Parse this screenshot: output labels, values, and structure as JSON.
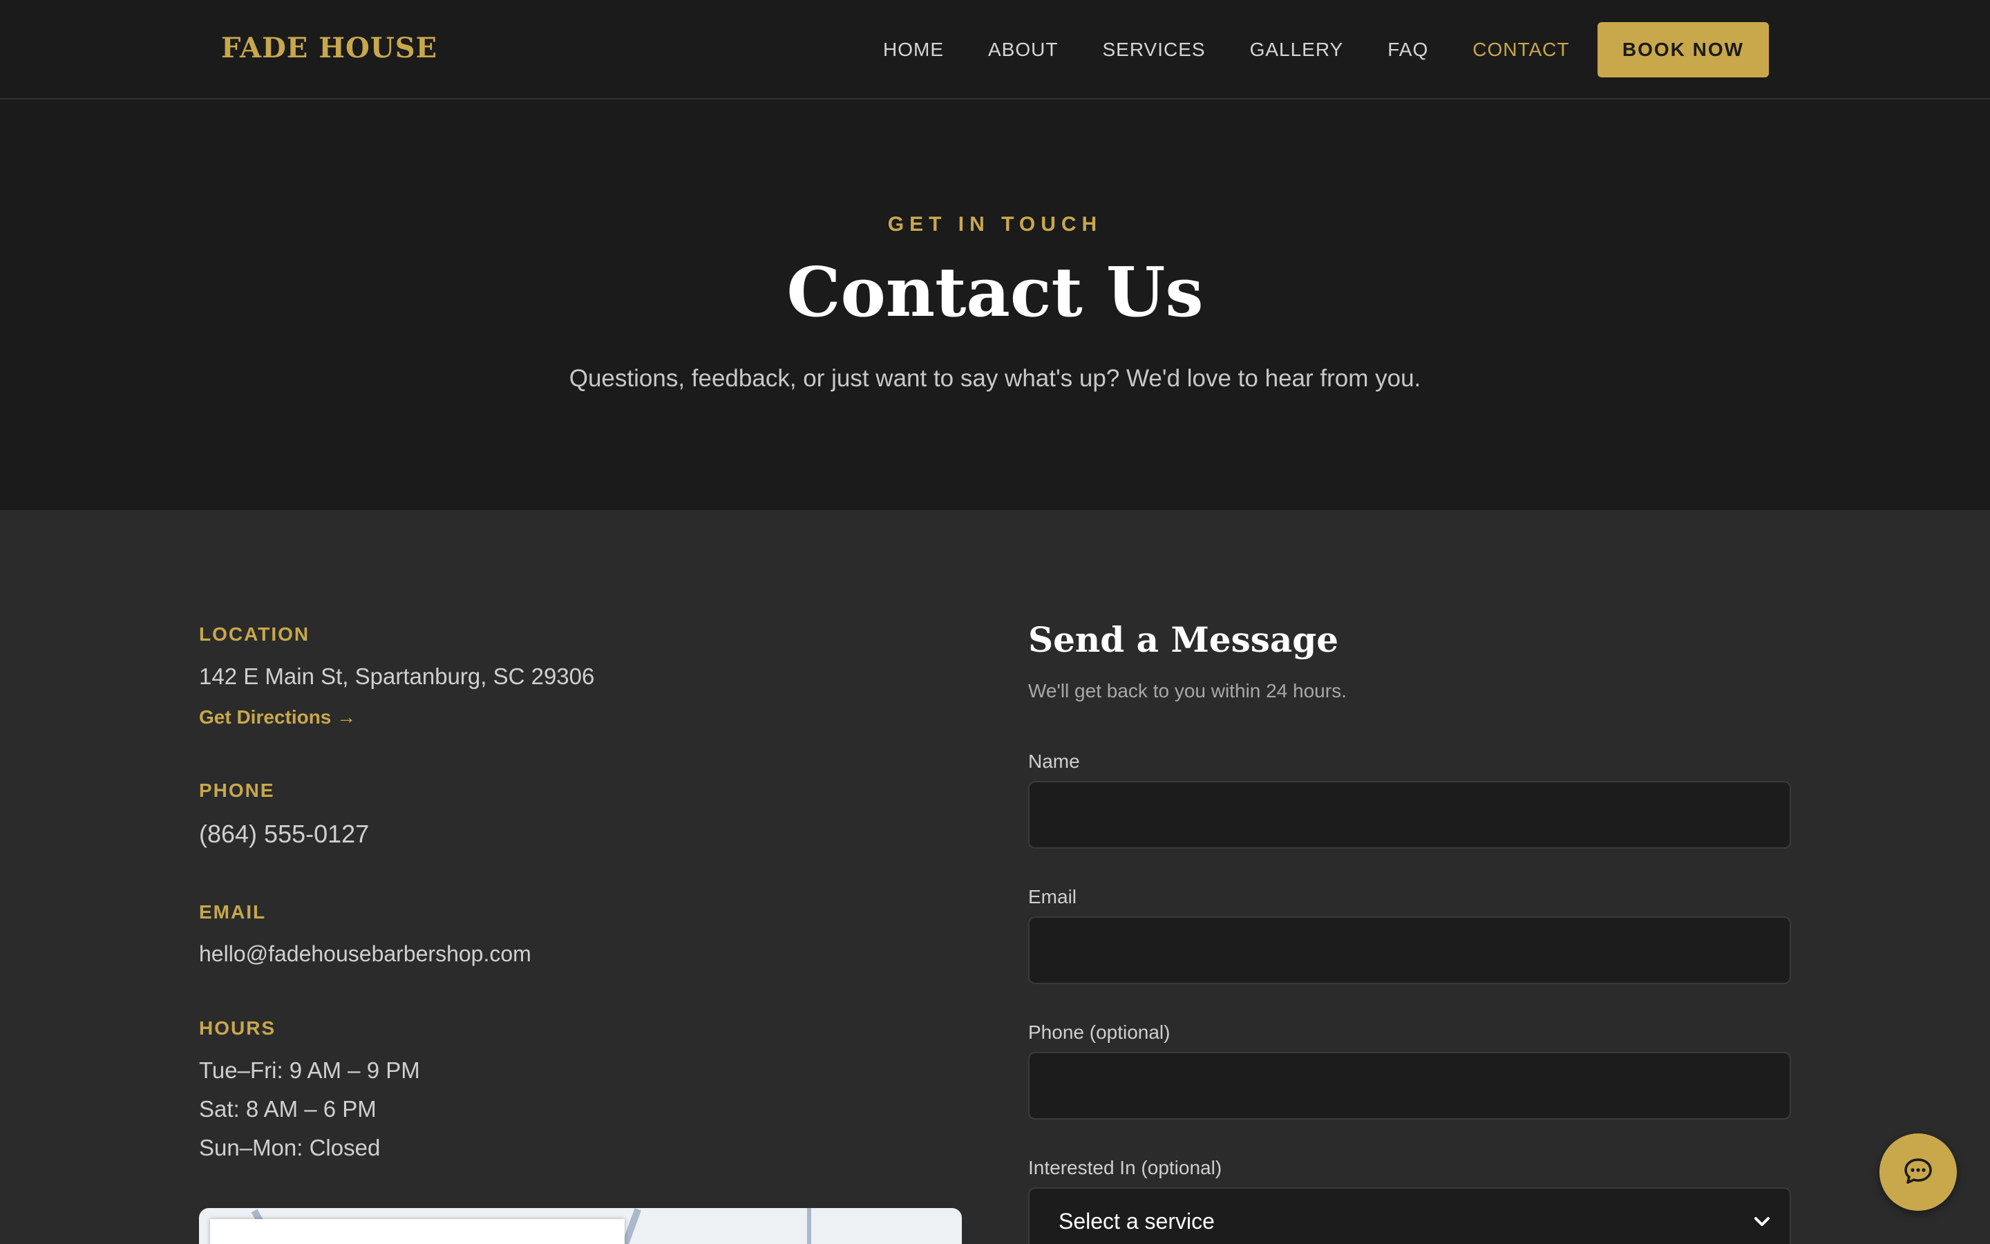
{
  "nav": {
    "logo": "FADE HOUSE",
    "links": [
      "HOME",
      "ABOUT",
      "SERVICES",
      "GALLERY",
      "FAQ",
      "CONTACT"
    ],
    "active": "CONTACT",
    "cta": "BOOK NOW"
  },
  "hero": {
    "eyebrow": "GET IN TOUCH",
    "title": "Contact Us",
    "subtitle": "Questions, feedback, or just want to say what's up? We'd love to hear from you."
  },
  "info": {
    "location_label": "LOCATION",
    "address": "142 E Main St, Spartanburg, SC 29306",
    "directions": "Get Directions →",
    "phone_label": "PHONE",
    "phone": "(864) 555-0127",
    "email_label": "EMAIL",
    "email": "hello@fadehousebarbershop.com",
    "hours_label": "HOURS",
    "hours": [
      "Tue–Fri: 9 AM – 9 PM",
      "Sat: 8 AM – 6 PM",
      "Sun–Mon: Closed"
    ]
  },
  "form": {
    "title": "Send a Message",
    "subtitle": "We'll get back to you within 24 hours.",
    "name_label": "Name",
    "name_value": "",
    "email_label": "Email",
    "email_value": "",
    "phone_label": "Phone (optional)",
    "phone_value": "",
    "interest_label": "Interested In (optional)",
    "interest_value": "Select a service"
  },
  "icons": {
    "chat": "chat-bubble-icon",
    "select": "chevron-down-icon"
  },
  "colors": {
    "accent": "#c9a84c",
    "nav_bg": "#1b1b1b",
    "body_bg": "#2b2b2b",
    "field_bg": "#1c1c1c"
  }
}
